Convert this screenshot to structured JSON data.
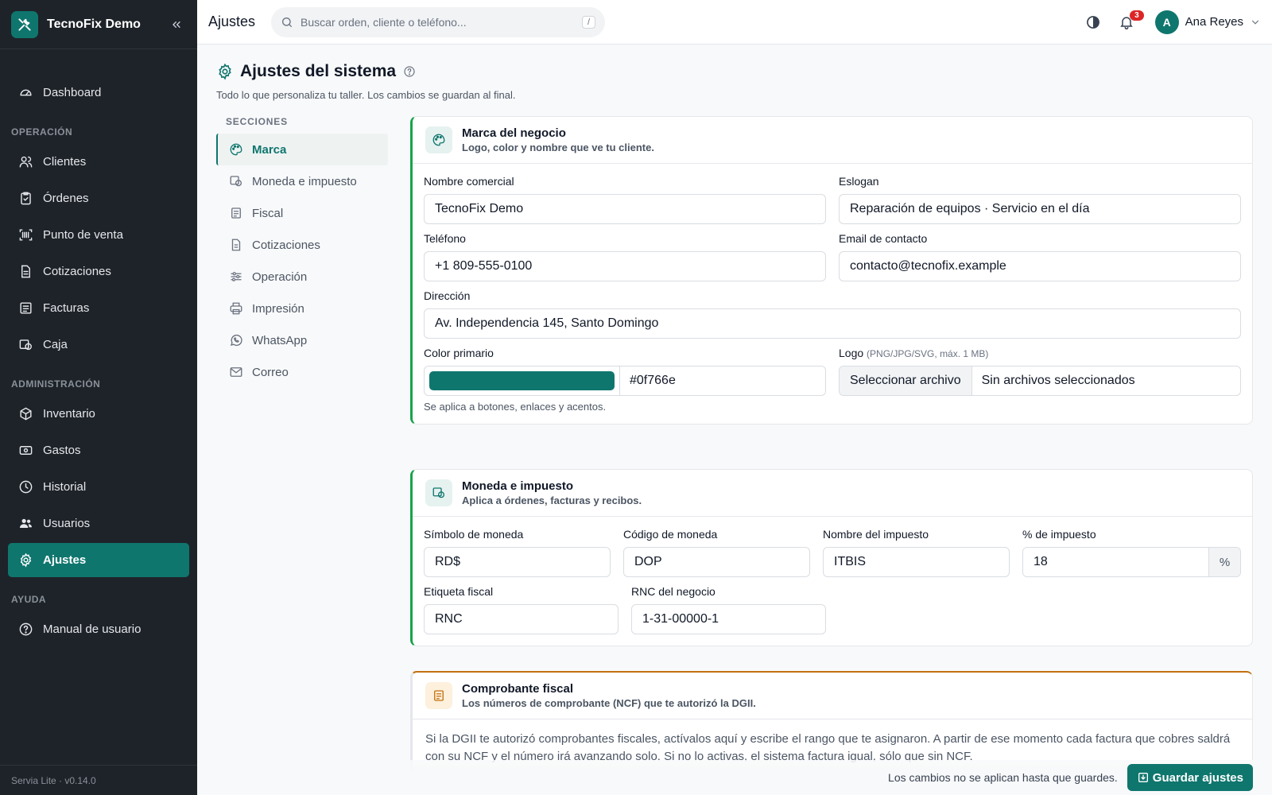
{
  "app": {
    "name": "TecnoFix Demo",
    "version": "Servia Lite · v0.14.0",
    "accent_color": "#0f766e"
  },
  "sidebar": {
    "dashboard": "Dashboard",
    "sections": [
      {
        "title": "Operación",
        "items": [
          "Clientes",
          "Órdenes",
          "Punto de venta",
          "Cotizaciones",
          "Facturas",
          "Caja"
        ]
      },
      {
        "title": "Administración",
        "items": [
          "Inventario",
          "Gastos",
          "Historial",
          "Usuarios",
          "Ajustes"
        ]
      },
      {
        "title": "Ayuda",
        "items": [
          "Manual de usuario"
        ]
      }
    ],
    "active": "Ajustes"
  },
  "topbar": {
    "title": "Ajustes",
    "search_placeholder": "Buscar orden, cliente o teléfono...",
    "search_shortcut": "/",
    "notifications_count": "3",
    "user_initial": "A",
    "user_name": "Ana Reyes"
  },
  "page": {
    "title": "Ajustes del sistema",
    "subtitle": "Todo lo que personaliza tu taller. Los cambios se guardan al final."
  },
  "sections_nav": {
    "title": "SECCIONES",
    "items": [
      "Marca",
      "Moneda e impuesto",
      "Fiscal",
      "Cotizaciones",
      "Operación",
      "Impresión",
      "WhatsApp",
      "Correo"
    ],
    "active": "Marca"
  },
  "brand_card": {
    "title": "Marca del negocio",
    "subtitle": "Logo, color y nombre que ve tu cliente.",
    "trade_name_label": "Nombre comercial",
    "trade_name_value": "TecnoFix Demo",
    "slogan_label": "Eslogan",
    "slogan_value": "Reparación de equipos · Servicio en el día",
    "phone_label": "Teléfono",
    "phone_value": "+1 809-555-0100",
    "email_label": "Email de contacto",
    "email_value": "contacto@tecnofix.example",
    "address_label": "Dirección",
    "address_value": "Av. Independencia 145, Santo Domingo",
    "color_label": "Color primario",
    "color_value": "#0f766e",
    "color_hint": "Se aplica a botones, enlaces y acentos.",
    "logo_label": "Logo",
    "logo_note": "(PNG/JPG/SVG, máx. 1 MB)",
    "logo_button": "Seleccionar archivo",
    "logo_file": "Sin archivos seleccionados"
  },
  "currency_card": {
    "title": "Moneda e impuesto",
    "subtitle": "Aplica a órdenes, facturas y recibos.",
    "symbol_label": "Símbolo de moneda",
    "symbol_value": "RD$",
    "code_label": "Código de moneda",
    "code_value": "DOP",
    "tax_name_label": "Nombre del impuesto",
    "tax_name_value": "ITBIS",
    "tax_pct_label": "% de impuesto",
    "tax_pct_value": "18",
    "tax_pct_suffix": "%",
    "fiscal_tag_label": "Etiqueta fiscal",
    "fiscal_tag_value": "RNC",
    "rnc_label": "RNC del negocio",
    "rnc_value": "1-31-00000-1"
  },
  "fiscal_card": {
    "title": "Comprobante fiscal",
    "subtitle": "Los números de comprobante (NCF) que te autorizó la DGII.",
    "body": "Si la DGII te autorizó comprobantes fiscales, actívalos aquí y escribe el rango que te asignaron. A partir de ese momento cada factura que cobres saldrá con su NCF y el número irá avanzando solo. Si no lo activas, el sistema factura igual, sólo que sin NCF."
  },
  "savebar": {
    "note": "Los cambios no se aplican hasta que guardes.",
    "button": "Guardar ajustes"
  }
}
